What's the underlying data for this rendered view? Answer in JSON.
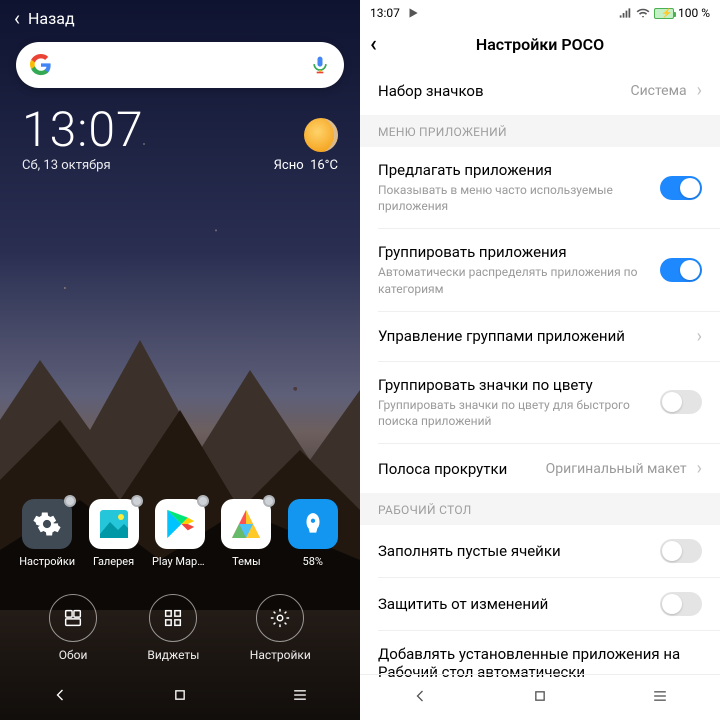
{
  "left": {
    "back_label": "Назад",
    "clock": "13:07",
    "date": "Сб, 13 октября",
    "weather_desc": "Ясно",
    "weather_temp": "16°C",
    "apps": [
      {
        "name": "Настройки"
      },
      {
        "name": "Галерея"
      },
      {
        "name": "Play Марк.."
      },
      {
        "name": "Темы"
      },
      {
        "name": "58%"
      }
    ],
    "quick": [
      {
        "name": "Обои"
      },
      {
        "name": "Виджеты"
      },
      {
        "name": "Настройки"
      }
    ]
  },
  "right": {
    "status_time": "13:07",
    "battery_pct": "100 %",
    "header_title": "Настройки POCO",
    "rows": {
      "icon_pack": {
        "title": "Набор значков",
        "value": "Система"
      },
      "section_apps": "МЕНЮ ПРИЛОЖЕНИЙ",
      "suggest": {
        "title": "Предлагать приложения",
        "sub": "Показывать в меню часто используемые приложения",
        "on": true
      },
      "group": {
        "title": "Группировать приложения",
        "sub": "Автоматически распределять приложения по категориям",
        "on": true
      },
      "manage_groups": {
        "title": "Управление группами приложений"
      },
      "group_color": {
        "title": "Группировать значки по цвету",
        "sub": "Группировать значки по цвету для быстрого поиска приложений",
        "on": false
      },
      "scrollbar": {
        "title": "Полоса прокрутки",
        "value": "Оригинальный макет"
      },
      "section_home": "РАБОЧИЙ СТОЛ",
      "fill_cells": {
        "title": "Заполнять пустые ячейки",
        "on": false
      },
      "lock_layout": {
        "title": "Защитить от изменений",
        "on": false
      },
      "auto_add": {
        "title": "Добавлять установленные приложения на Рабочий стол автоматически"
      }
    }
  }
}
